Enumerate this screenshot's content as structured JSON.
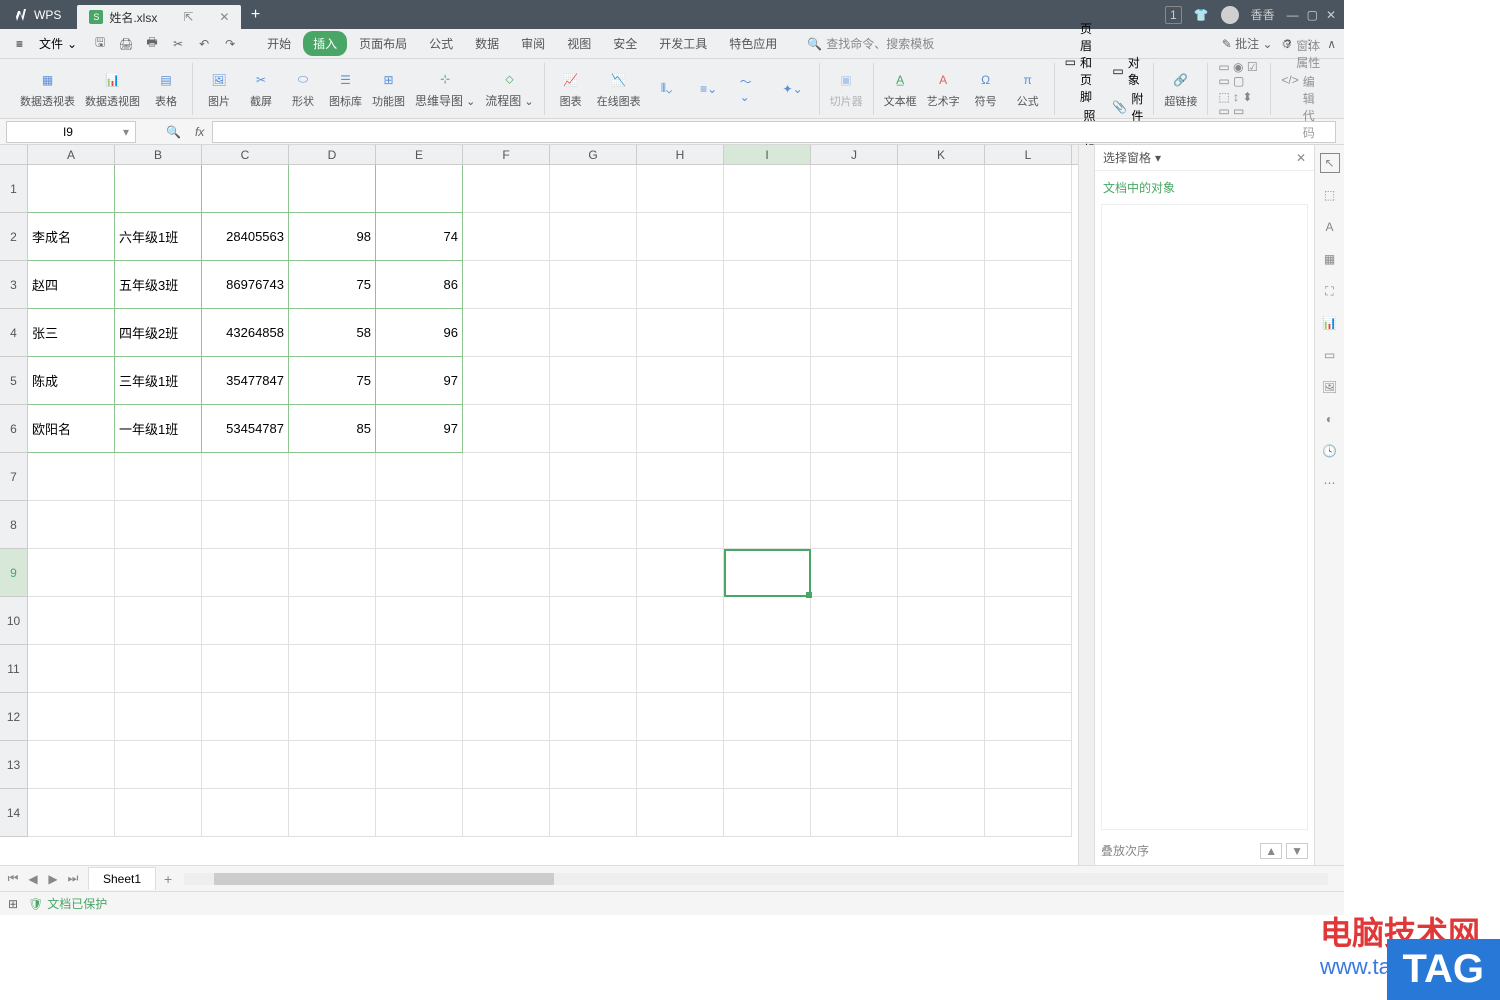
{
  "title_bar": {
    "wps_label": "WPS",
    "file_name": "姓名.xlsx",
    "user_name": "香香"
  },
  "menu": {
    "file_btn": "文件",
    "tabs": [
      "开始",
      "插入",
      "页面布局",
      "公式",
      "数据",
      "审阅",
      "视图",
      "安全",
      "开发工具",
      "特色应用"
    ],
    "active_tab_index": 1,
    "search_placeholder": "查找命令、搜索模板",
    "annotate": "批注"
  },
  "ribbon": {
    "pivot_table": "数据透视表",
    "pivot_chart": "数据透视图",
    "table": "表格",
    "picture": "图片",
    "screenshot": "截屏",
    "shapes": "形状",
    "icon_lib": "图标库",
    "function_chart": "功能图",
    "mindmap": "思维导图",
    "flowchart": "流程图",
    "chart": "图表",
    "online_chart": "在线图表",
    "slicer": "切片器",
    "textbox": "文本框",
    "wordart": "艺术字",
    "symbol": "符号",
    "equation": "公式",
    "header_footer": "页眉和页脚",
    "object": "对象",
    "camera": "照相机",
    "attachment": "附件",
    "hyperlink": "超链接",
    "form_prop": "窗体属性",
    "edit_code": "编辑代码"
  },
  "formula_bar": {
    "cell_ref": "I9"
  },
  "columns": [
    "A",
    "B",
    "C",
    "D",
    "E",
    "F",
    "G",
    "H",
    "I",
    "J",
    "K",
    "L"
  ],
  "active_col": "I",
  "active_row": 9,
  "row_count": 14,
  "data": [
    null,
    {
      "A": "李成名",
      "B": "六年级1班",
      "C": "28405563",
      "D": "98",
      "E": "74"
    },
    {
      "A": "赵四",
      "B": "五年级3班",
      "C": "86976743",
      "D": "75",
      "E": "86"
    },
    {
      "A": "张三",
      "B": "四年级2班",
      "C": "43264858",
      "D": "58",
      "E": "96"
    },
    {
      "A": "陈成",
      "B": "三年级1班",
      "C": "35477847",
      "D": "75",
      "E": "97"
    },
    {
      "A": "欧阳名",
      "B": "一年级1班",
      "C": "53454787",
      "D": "85",
      "E": "97"
    }
  ],
  "side_panel": {
    "title": "选择窗格",
    "subtitle": "文档中的对象",
    "footer": "叠放次序"
  },
  "sheet": {
    "name": "Sheet1"
  },
  "status": {
    "protected": "文档已保护"
  },
  "watermark": {
    "line1": "电脑技术网",
    "line2": "www.tagxp.com",
    "tag": "TAG"
  }
}
